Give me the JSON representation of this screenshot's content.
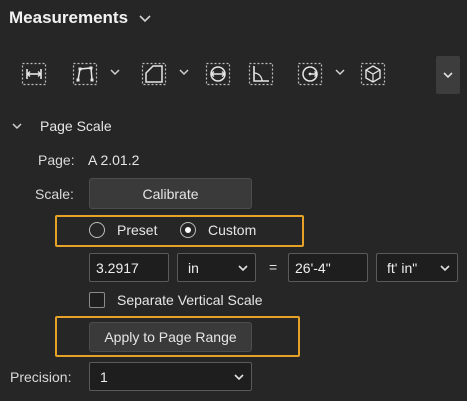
{
  "panel": {
    "title": "Measurements",
    "title_icon": "chevron-down-icon"
  },
  "toolbar": {
    "tools": [
      {
        "name": "length-tool",
        "icon": "length-icon",
        "has_menu": false
      },
      {
        "name": "polylength-tool",
        "icon": "polylength-icon",
        "has_menu": true
      },
      {
        "name": "area-tool",
        "icon": "area-icon",
        "has_menu": true
      },
      {
        "name": "diameter-tool",
        "icon": "diameter-icon",
        "has_menu": false
      },
      {
        "name": "angle-tool",
        "icon": "angle-icon",
        "has_menu": false
      },
      {
        "name": "radius-tool",
        "icon": "radius-icon",
        "has_menu": true
      },
      {
        "name": "volume-tool",
        "icon": "volume-icon",
        "has_menu": false
      }
    ],
    "overflow_icon": "chevron-down-icon"
  },
  "page_scale": {
    "header": "Page Scale",
    "page_label": "Page:",
    "page_value": "A 2.01.2",
    "scale_label": "Scale:",
    "calibrate_label": "Calibrate",
    "preset_label": "Preset",
    "custom_label": "Custom",
    "selected_mode": "Custom",
    "scale_left_value": "3.2917",
    "scale_left_unit": "in",
    "equals": "=",
    "scale_right_value": "26'-4\"",
    "scale_right_unit": "ft' in\"",
    "separate_vertical_label": "Separate Vertical Scale",
    "separate_vertical_checked": false,
    "apply_label": "Apply to Page Range",
    "precision_label": "Precision:",
    "precision_value": "1"
  },
  "colors": {
    "background": "#262626",
    "highlight": "#e5a226"
  }
}
